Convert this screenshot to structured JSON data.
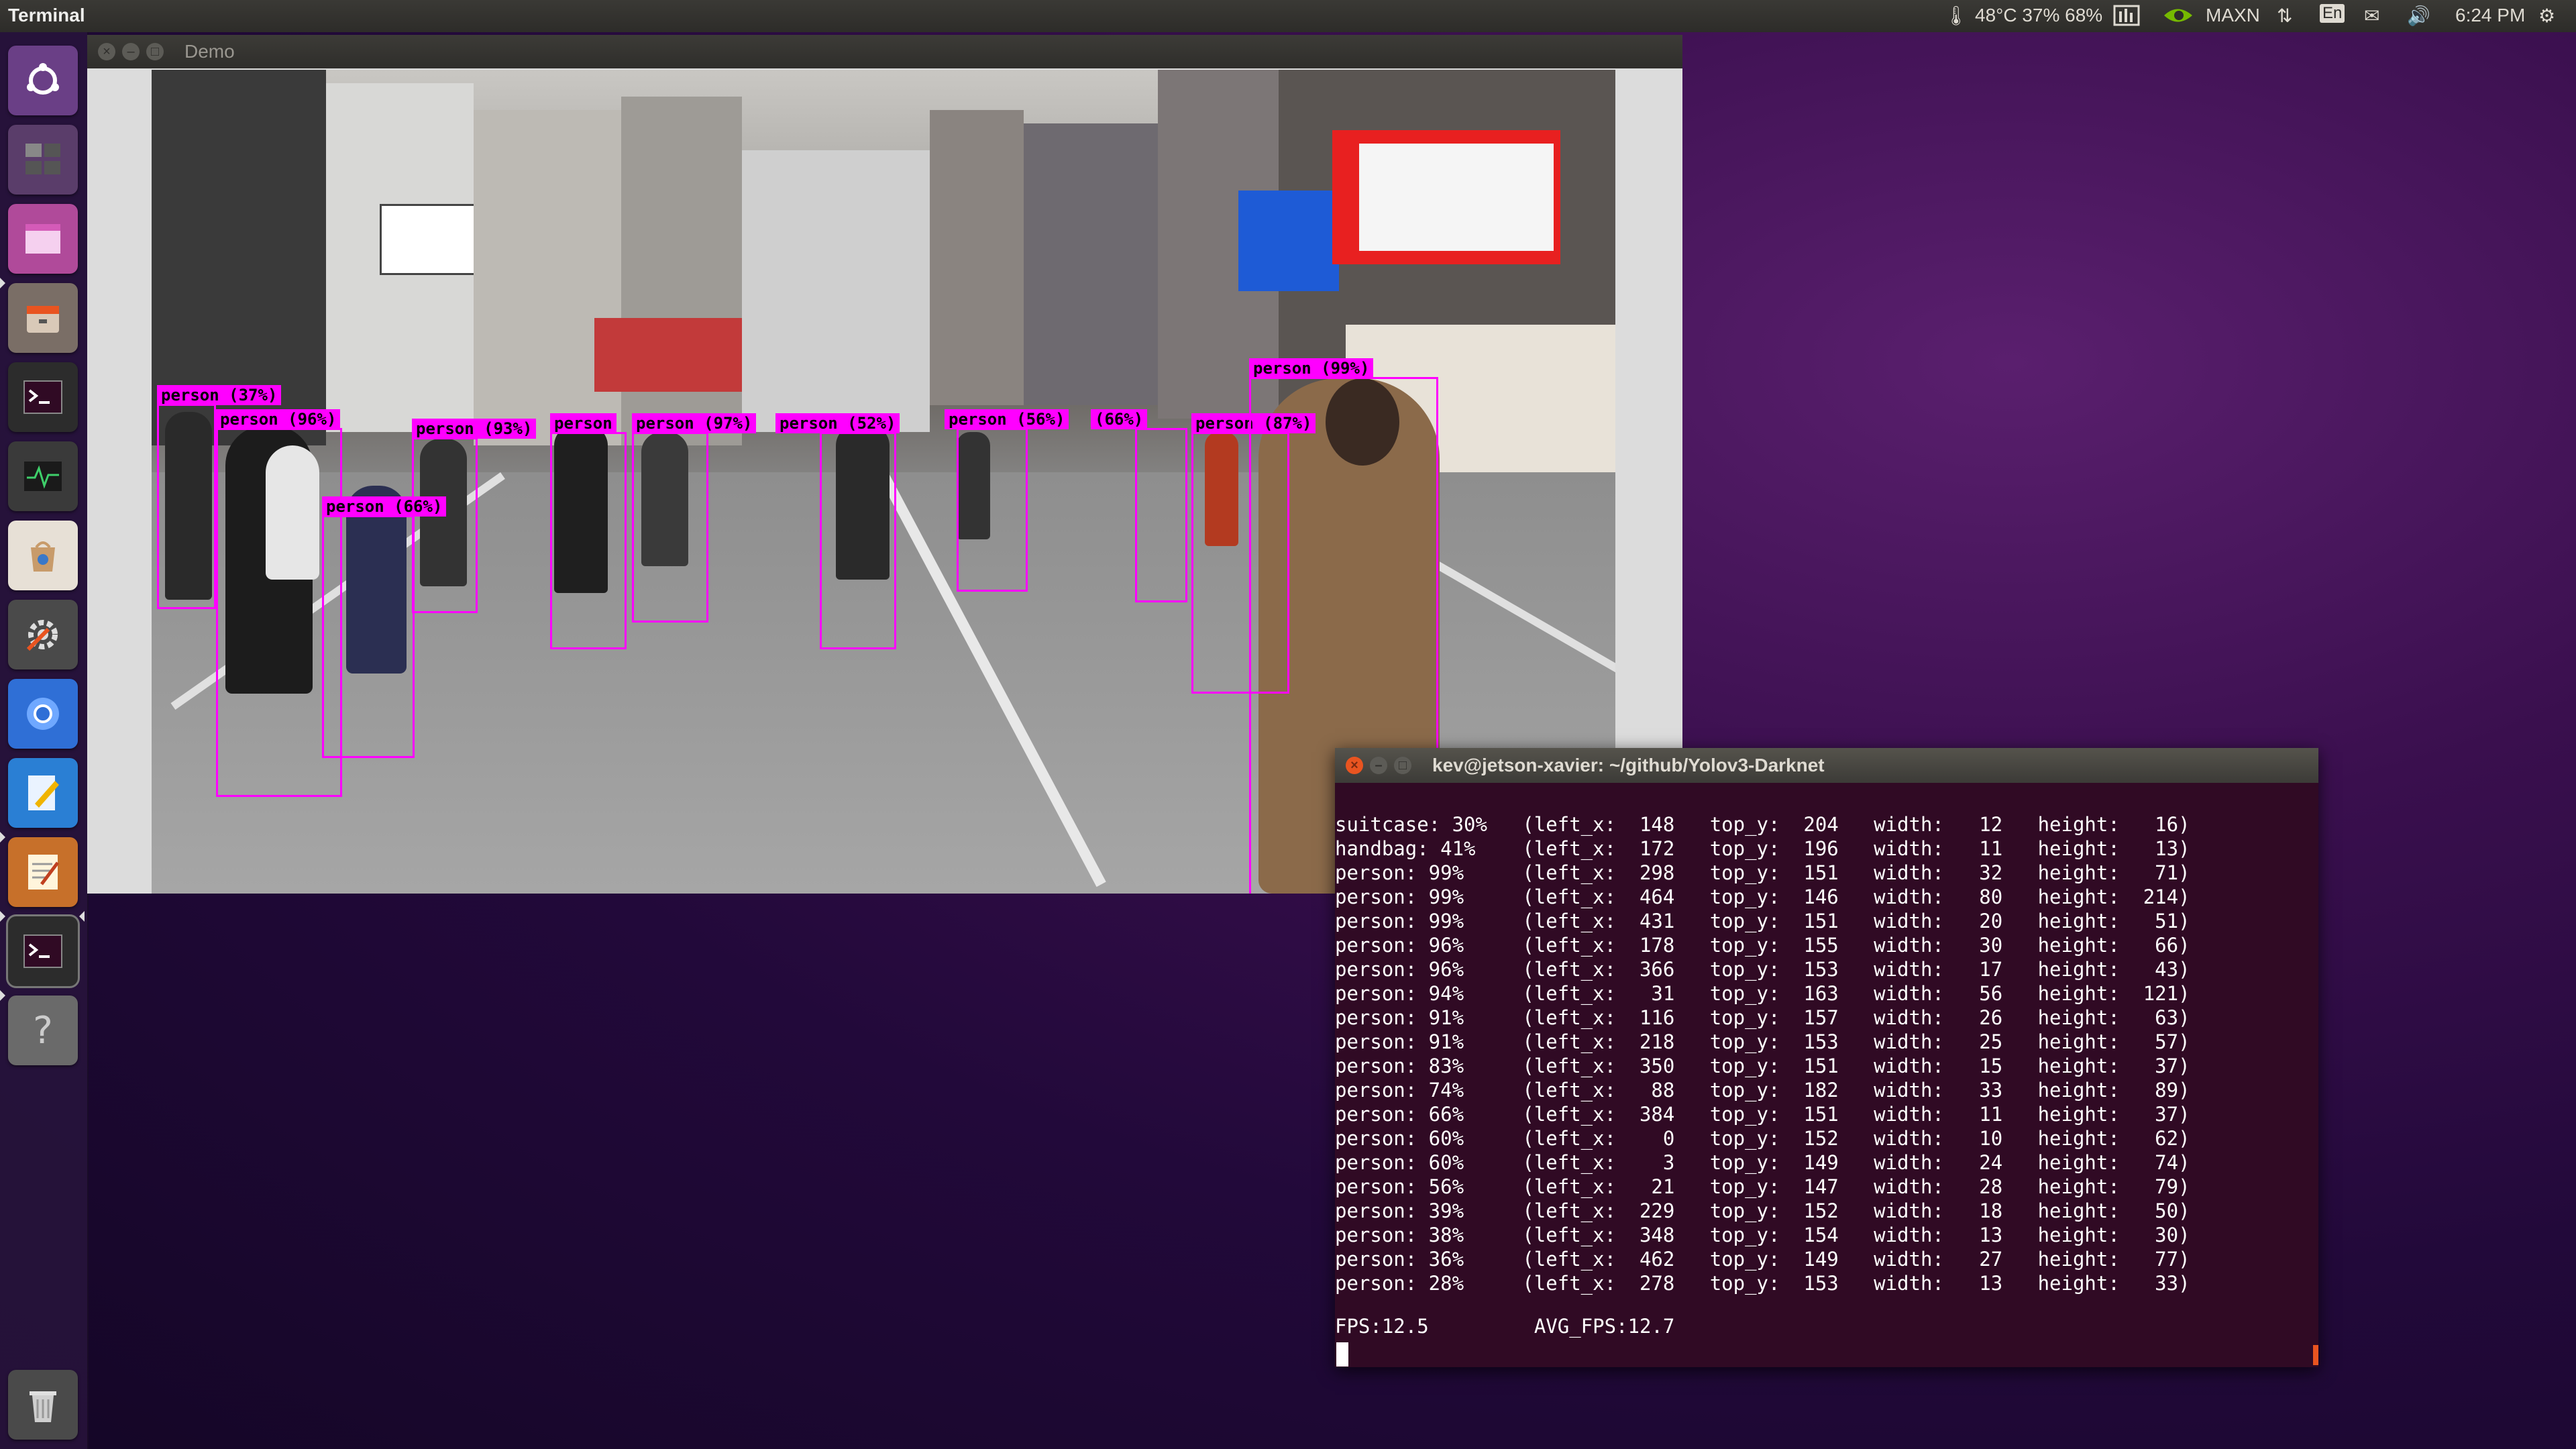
{
  "topbar": {
    "app_title": "Terminal",
    "status": "48°C 37% 68%",
    "power_mode": "MAXN",
    "keyboard": "En",
    "clock": "6:24 PM"
  },
  "launcher": {
    "items": [
      "dash-home",
      "workspaces",
      "app-window",
      "files",
      "terminal",
      "system-monitor",
      "software-center",
      "system-settings",
      "chromium",
      "text-editor",
      "notes",
      "terminal",
      "help",
      "trash"
    ]
  },
  "demo_window": {
    "title": "Demo",
    "detections": [
      {
        "label": "person (37%)"
      },
      {
        "label": "person (96%)"
      },
      {
        "label": "person (93%)"
      },
      {
        "label": "person (66%)"
      },
      {
        "label": "person"
      },
      {
        "label": "person (97%)"
      },
      {
        "label": "person (52%)"
      },
      {
        "label": "person (56%)"
      },
      {
        "label": "(66%)"
      },
      {
        "label": "person (87%)"
      },
      {
        "label": "person (99%)"
      }
    ]
  },
  "terminal": {
    "title": "kev@jetson-xavier: ~/github/Yolov3-Darknet",
    "lines": [
      "suitcase: 30%   (left_x:  148   top_y:  204   width:   12   height:   16)",
      "handbag: 41%    (left_x:  172   top_y:  196   width:   11   height:   13)",
      "person: 99%     (left_x:  298   top_y:  151   width:   32   height:   71)",
      "person: 99%     (left_x:  464   top_y:  146   width:   80   height:  214)",
      "person: 99%     (left_x:  431   top_y:  151   width:   20   height:   51)",
      "person: 96%     (left_x:  178   top_y:  155   width:   30   height:   66)",
      "person: 96%     (left_x:  366   top_y:  153   width:   17   height:   43)",
      "person: 94%     (left_x:   31   top_y:  163   width:   56   height:  121)",
      "person: 91%     (left_x:  116   top_y:  157   width:   26   height:   63)",
      "person: 91%     (left_x:  218   top_y:  153   width:   25   height:   57)",
      "person: 83%     (left_x:  350   top_y:  151   width:   15   height:   37)",
      "person: 74%     (left_x:   88   top_y:  182   width:   33   height:   89)",
      "person: 66%     (left_x:  384   top_y:  151   width:   11   height:   37)",
      "person: 60%     (left_x:    0   top_y:  152   width:   10   height:   62)",
      "person: 60%     (left_x:    3   top_y:  149   width:   24   height:   74)",
      "person: 56%     (left_x:   21   top_y:  147   width:   28   height:   79)",
      "person: 39%     (left_x:  229   top_y:  152   width:   18   height:   50)",
      "person: 38%     (left_x:  348   top_y:  154   width:   13   height:   30)",
      "person: 36%     (left_x:  462   top_y:  149   width:   27   height:   77)",
      "person: 28%     (left_x:  278   top_y:  153   width:   13   height:   33)"
    ],
    "fps": "FPS:12.5",
    "avg_fps": "AVG_FPS:12.7"
  }
}
